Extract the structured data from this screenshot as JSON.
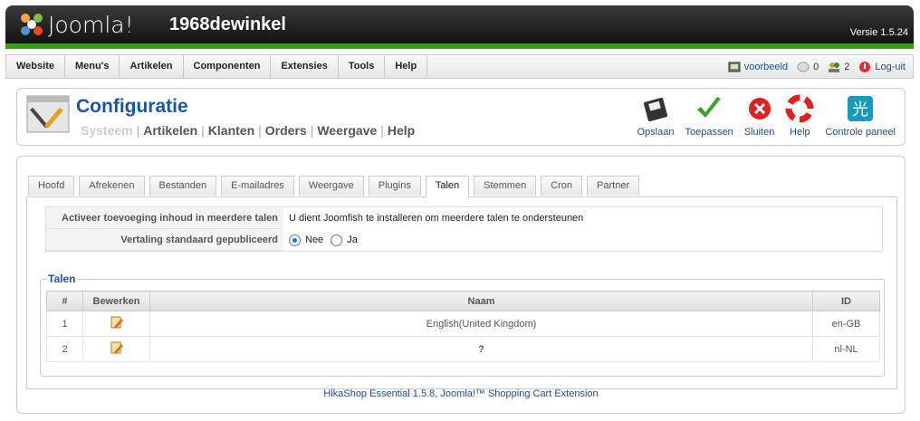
{
  "header": {
    "brand": "Joomla!",
    "site_name": "1968dewinkel",
    "version": "Versie 1.5.24"
  },
  "menu": [
    "Website",
    "Menu's",
    "Artikelen",
    "Componenten",
    "Extensies",
    "Tools",
    "Help"
  ],
  "status": {
    "preview": "voorbeeld",
    "messages": "0",
    "users": "2",
    "logout": "Log-uit"
  },
  "page": {
    "title": "Configuratie",
    "sublinks": [
      "Systeem",
      "Artikelen",
      "Klanten",
      "Orders",
      "Weergave",
      "Help"
    ]
  },
  "toolbar": [
    "Opslaan",
    "Toepassen",
    "Sluiten",
    "Help",
    "Controle paneel"
  ],
  "tabs": [
    "Hoofd",
    "Afrekenen",
    "Bestanden",
    "E-mailadres",
    "Weergave",
    "Plugins",
    "Talen",
    "Stemmen",
    "Cron",
    "Partner"
  ],
  "active_tab": "Talen",
  "options": {
    "multi_label": "Activeer toevoeging inhoud in meerdere talen",
    "multi_value": "U dient Joomfish te installeren om meerdere talen te ondersteunen",
    "publish_label": "Vertaling standaard gepubliceerd",
    "radio_no": "Nee",
    "radio_yes": "Ja",
    "selected": "Nee"
  },
  "languages": {
    "legend": "Talen",
    "columns": [
      "#",
      "Bewerken",
      "Naam",
      "ID"
    ],
    "rows": [
      {
        "num": "1",
        "name": "English(United Kingdom)",
        "id": "en-GB"
      },
      {
        "num": "2",
        "name": "?",
        "id": "nl-NL"
      }
    ]
  },
  "footer": "HikaShop Essential 1.5.8, Joomla!™ Shopping Cart Extension",
  "colors": {
    "accent": "#1a56a6",
    "green": "#3e9c14"
  }
}
